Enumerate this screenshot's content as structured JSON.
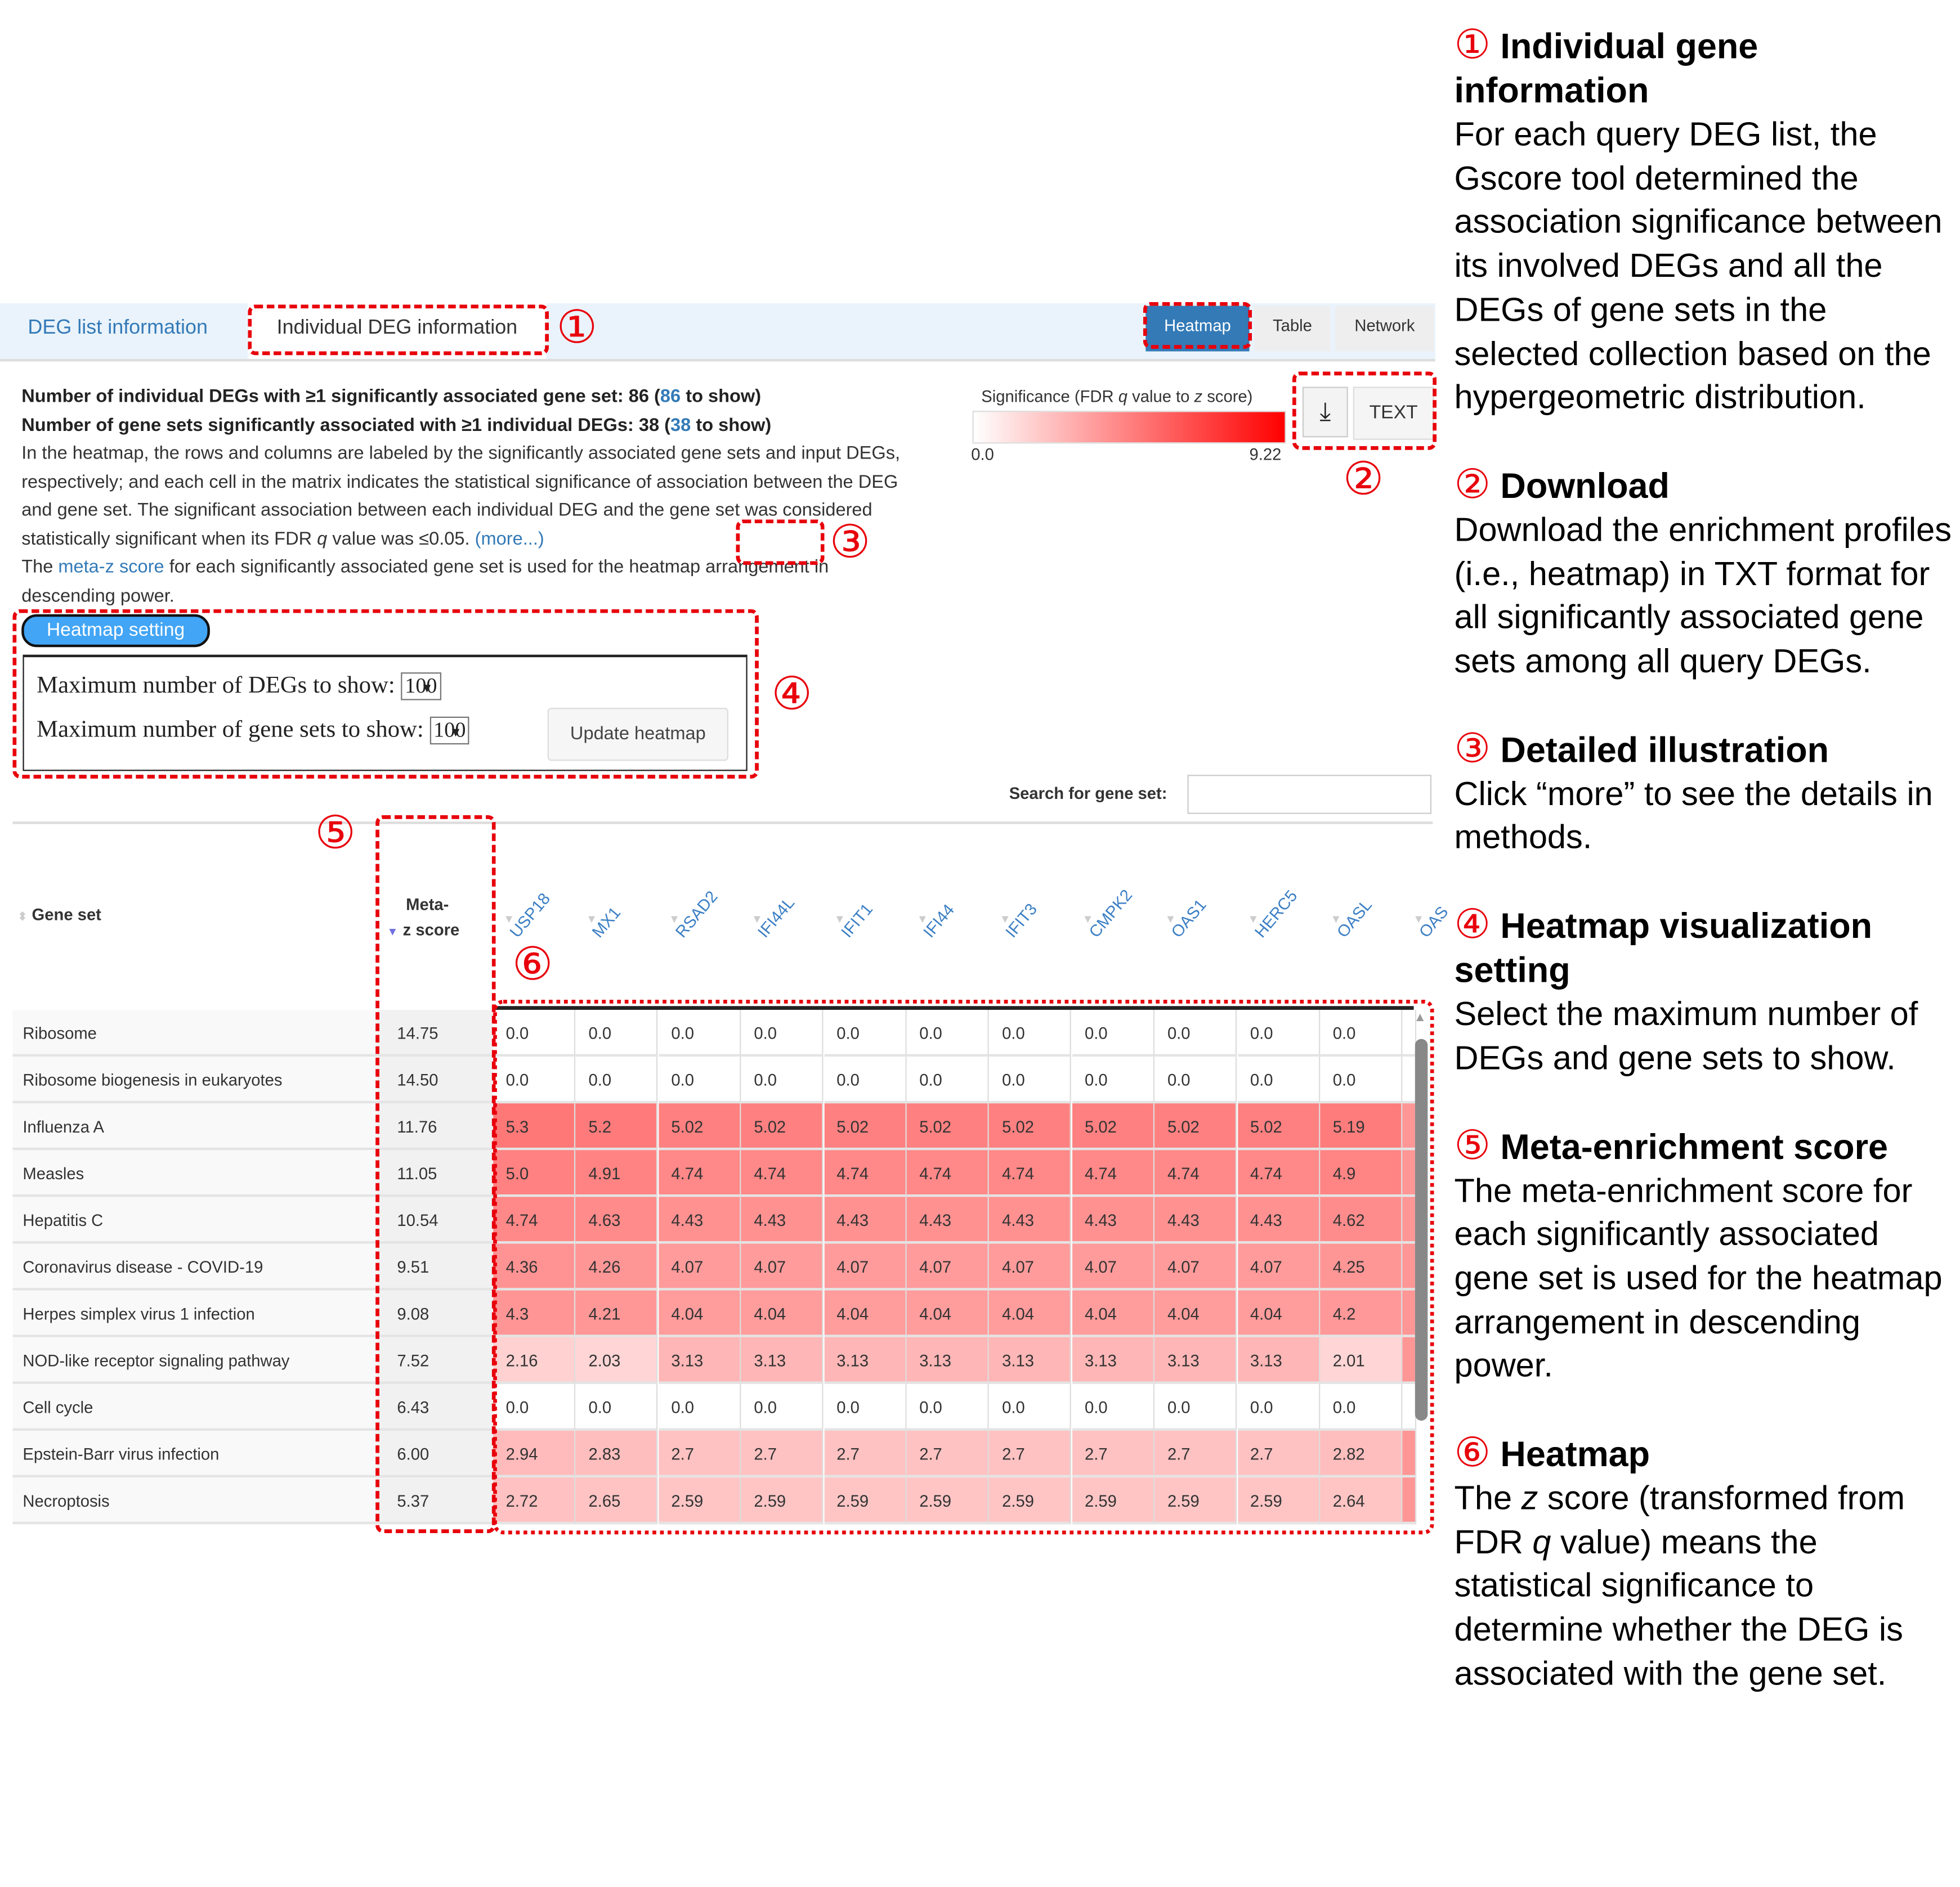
{
  "tabs": {
    "deg_list": "DEG list information",
    "individual": "Individual DEG information"
  },
  "view_buttons": [
    "Heatmap",
    "Table",
    "Network"
  ],
  "info": {
    "line1_pre": "Number of individual DEGs with ≥1 significantly associated gene set: 86 (",
    "line1_link": "86",
    "line1_post": " to show)",
    "line2_pre": "Number of gene sets significantly associated with ≥1 individual DEGs: 38 (",
    "line2_link": "38",
    "line2_post": " to show)",
    "para1": "In the heatmap, the rows and columns are labeled by the significantly associated gene sets and input DEGs, respectively; and each cell in the matrix indicates the statistical significance of association between the DEG and gene set. The significant association between each individual DEG and the gene set was considered statistically significant when its FDR ",
    "q": "q",
    "para1b": " value was ≤0.05.",
    "more": "(more...)",
    "para2_pre": "The ",
    "para2_link": "meta-z score",
    "para2_post": " for each significantly associated gene set is used for the heatmap arrangement in descending power."
  },
  "legend": {
    "title_pre": "Significance (FDR ",
    "q": "q",
    "title_mid": " value to ",
    "z": "z",
    "title_post": " score)",
    "min": "0.0",
    "max": "9.22",
    "color_min": "#ffffff",
    "color_max": "#ff0000"
  },
  "download": {
    "icon": "download-icon",
    "text_label": "TEXT"
  },
  "heatmap_setting": {
    "label": "Heatmap setting",
    "max_degs_label": "Maximum number of DEGs to show:",
    "max_degs_value": "100",
    "max_sets_label": "Maximum number of gene sets to show:",
    "max_sets_value": "100",
    "update_label": "Update heatmap"
  },
  "search": {
    "label": "Search for gene set:",
    "value": ""
  },
  "table": {
    "gene_set_header": "Gene set",
    "meta_header_1": "Meta-",
    "meta_header_2": "z score",
    "columns": [
      "USP18",
      "MX1",
      "RSAD2",
      "IFI44L",
      "IFIT1",
      "IFI44",
      "IFIT3",
      "CMPK2",
      "OAS1",
      "HERC5",
      "OASL",
      "OAS"
    ],
    "rows": [
      {
        "name": "Ribosome",
        "meta": "14.75",
        "values": [
          "0.0",
          "0.0",
          "0.0",
          "0.0",
          "0.0",
          "0.0",
          "0.0",
          "0.0",
          "0.0",
          "0.0",
          "0.0"
        ]
      },
      {
        "name": "Ribosome biogenesis in eukaryotes",
        "meta": "14.50",
        "values": [
          "0.0",
          "0.0",
          "0.0",
          "0.0",
          "0.0",
          "0.0",
          "0.0",
          "0.0",
          "0.0",
          "0.0",
          "0.0"
        ]
      },
      {
        "name": "Influenza A",
        "meta": "11.76",
        "values": [
          "5.3",
          "5.2",
          "5.02",
          "5.02",
          "5.02",
          "5.02",
          "5.02",
          "5.02",
          "5.02",
          "5.02",
          "5.19"
        ]
      },
      {
        "name": "Measles",
        "meta": "11.05",
        "values": [
          "5.0",
          "4.91",
          "4.74",
          "4.74",
          "4.74",
          "4.74",
          "4.74",
          "4.74",
          "4.74",
          "4.74",
          "4.9"
        ]
      },
      {
        "name": "Hepatitis C",
        "meta": "10.54",
        "values": [
          "4.74",
          "4.63",
          "4.43",
          "4.43",
          "4.43",
          "4.43",
          "4.43",
          "4.43",
          "4.43",
          "4.43",
          "4.62"
        ]
      },
      {
        "name": "Coronavirus disease - COVID-19",
        "meta": "9.51",
        "values": [
          "4.36",
          "4.26",
          "4.07",
          "4.07",
          "4.07",
          "4.07",
          "4.07",
          "4.07",
          "4.07",
          "4.07",
          "4.25"
        ]
      },
      {
        "name": "Herpes simplex virus 1 infection",
        "meta": "9.08",
        "values": [
          "4.3",
          "4.21",
          "4.04",
          "4.04",
          "4.04",
          "4.04",
          "4.04",
          "4.04",
          "4.04",
          "4.04",
          "4.2"
        ]
      },
      {
        "name": "NOD-like receptor signaling pathway",
        "meta": "7.52",
        "values": [
          "2.16",
          "2.03",
          "3.13",
          "3.13",
          "3.13",
          "3.13",
          "3.13",
          "3.13",
          "3.13",
          "3.13",
          "2.01"
        ]
      },
      {
        "name": "Cell cycle",
        "meta": "6.43",
        "values": [
          "0.0",
          "0.0",
          "0.0",
          "0.0",
          "0.0",
          "0.0",
          "0.0",
          "0.0",
          "0.0",
          "0.0",
          "0.0"
        ]
      },
      {
        "name": "Epstein-Barr virus infection",
        "meta": "6.00",
        "values": [
          "2.94",
          "2.83",
          "2.7",
          "2.7",
          "2.7",
          "2.7",
          "2.7",
          "2.7",
          "2.7",
          "2.7",
          "2.82"
        ]
      },
      {
        "name": "Necroptosis",
        "meta": "5.37",
        "values": [
          "2.72",
          "2.65",
          "2.59",
          "2.59",
          "2.59",
          "2.59",
          "2.59",
          "2.59",
          "2.59",
          "2.59",
          "2.64"
        ]
      }
    ]
  },
  "markers": [
    "①",
    "②",
    "③",
    "④",
    "⑤",
    "⑥"
  ],
  "notes": [
    {
      "title": "Individual gene information",
      "body": "For each query DEG list, the Gscore tool determined the association significance between its involved DEGs and all the DEGs of gene sets in the selected collection based on the hypergeometric distribution."
    },
    {
      "title": "Download",
      "body": "Download the enrichment profiles (i.e., heatmap) in TXT format for all significantly associated gene sets among all query DEGs."
    },
    {
      "title": "Detailed illustration",
      "body": "Click “more” to see the details in methods."
    },
    {
      "title": "Heatmap visualization setting",
      "body": "Select the maximum number of DEGs and gene sets to show."
    },
    {
      "title": "Meta-enrichment score",
      "body": "The meta-enrichment score for each significantly associated gene set is used for the heatmap arrangement in descending power."
    },
    {
      "title": "Heatmap",
      "body_pre": "The ",
      "body_z": "z",
      "body_mid": " score (transformed from FDR ",
      "body_q": "q",
      "body_post": " value) means the statistical significance to determine whether the DEG is associated with the gene set."
    }
  ]
}
